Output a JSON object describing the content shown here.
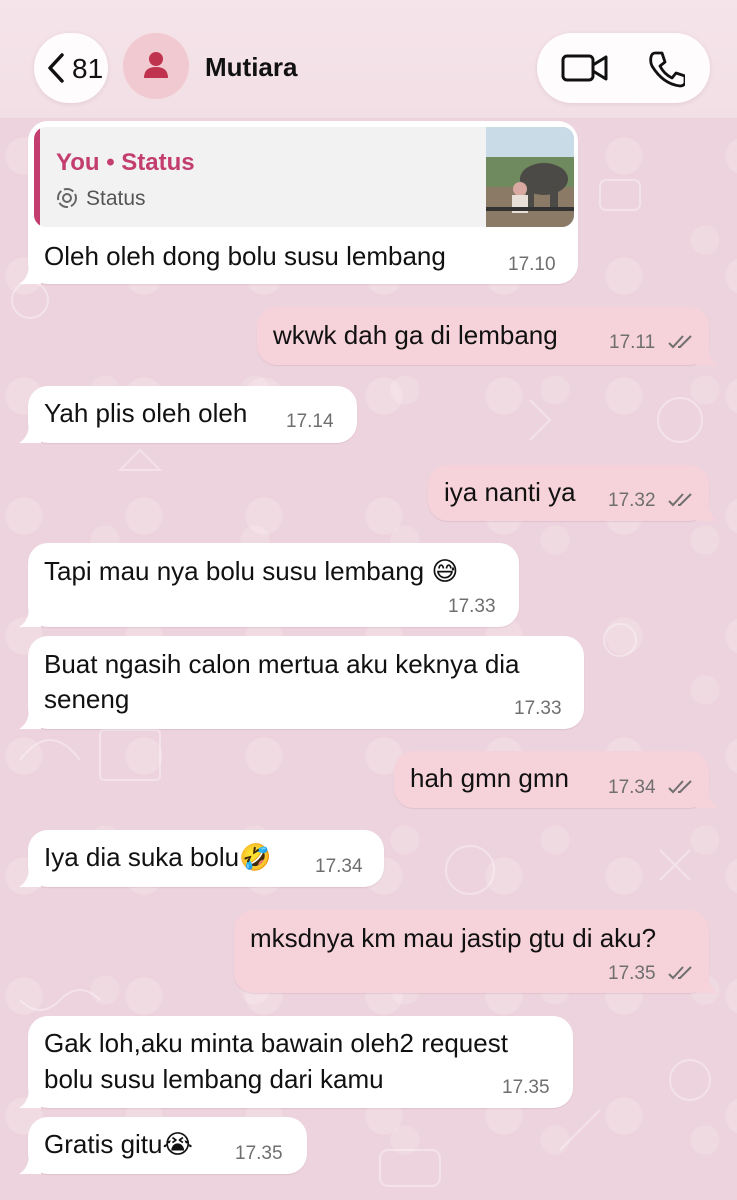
{
  "header": {
    "back_count": "81",
    "contact_name": "Mutiara",
    "icons": {
      "back": "chevron-left-icon",
      "avatar": "person-icon",
      "video": "video-camera-icon",
      "call": "phone-icon"
    }
  },
  "colors": {
    "outgoing_bubble": "#f6d2db",
    "incoming_bubble": "#ffffff",
    "accent": "#c33d6e",
    "chat_background": "#edd3dd"
  },
  "quote": {
    "title": "You • Status",
    "subtitle": "Status"
  },
  "messages": [
    {
      "direction": "in",
      "text": "Oleh oleh dong bolu susu lembang",
      "time": "17.10"
    },
    {
      "direction": "out",
      "text": "wkwk dah ga di lembang",
      "time": "17.11",
      "read": true
    },
    {
      "direction": "in",
      "text": "Yah plis oleh oleh",
      "time": "17.14"
    },
    {
      "direction": "out",
      "text": "iya nanti ya",
      "time": "17.32",
      "read": true
    },
    {
      "direction": "in",
      "text": "Tapi mau nya bolu susu lembang 😅",
      "time": "17.33"
    },
    {
      "direction": "in",
      "lines": [
        "Buat ngasih calon mertua aku keknya dia",
        "seneng"
      ],
      "time": "17.33"
    },
    {
      "direction": "out",
      "text": "hah gmn gmn",
      "time": "17.34",
      "read": true
    },
    {
      "direction": "in",
      "text": "Iya dia suka bolu🤣",
      "time": "17.34"
    },
    {
      "direction": "out",
      "text": "mksdnya km mau jastip gtu di aku?",
      "time": "17.35",
      "read": true
    },
    {
      "direction": "in",
      "lines": [
        "Gak loh,aku minta bawain oleh2 request",
        "bolu susu lembang dari kamu"
      ],
      "time": "17.35"
    },
    {
      "direction": "in",
      "text": "Gratis gitu😭",
      "time": "17.35"
    }
  ]
}
